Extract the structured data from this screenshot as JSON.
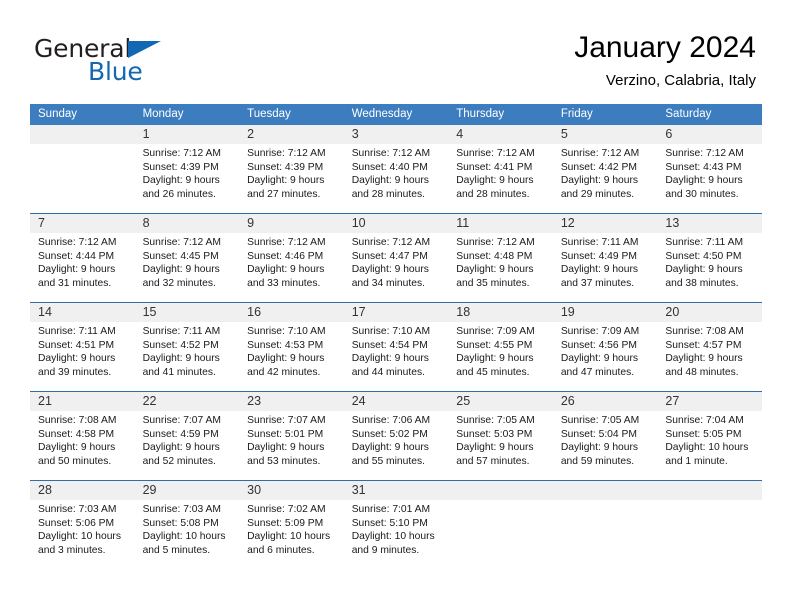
{
  "brand": {
    "name_part1": "General",
    "name_part2": "Blue",
    "accent_color": "#1268b3"
  },
  "header": {
    "month_title": "January 2024",
    "location": "Verzino, Calabria, Italy"
  },
  "calendar": {
    "header_color": "#3c7dc0",
    "weekday_headers": [
      "Sunday",
      "Monday",
      "Tuesday",
      "Wednesday",
      "Thursday",
      "Friday",
      "Saturday"
    ],
    "weeks": [
      [
        {
          "day": "",
          "lines": []
        },
        {
          "day": "1",
          "lines": [
            "Sunrise: 7:12 AM",
            "Sunset: 4:39 PM",
            "Daylight: 9 hours",
            "and 26 minutes."
          ]
        },
        {
          "day": "2",
          "lines": [
            "Sunrise: 7:12 AM",
            "Sunset: 4:39 PM",
            "Daylight: 9 hours",
            "and 27 minutes."
          ]
        },
        {
          "day": "3",
          "lines": [
            "Sunrise: 7:12 AM",
            "Sunset: 4:40 PM",
            "Daylight: 9 hours",
            "and 28 minutes."
          ]
        },
        {
          "day": "4",
          "lines": [
            "Sunrise: 7:12 AM",
            "Sunset: 4:41 PM",
            "Daylight: 9 hours",
            "and 28 minutes."
          ]
        },
        {
          "day": "5",
          "lines": [
            "Sunrise: 7:12 AM",
            "Sunset: 4:42 PM",
            "Daylight: 9 hours",
            "and 29 minutes."
          ]
        },
        {
          "day": "6",
          "lines": [
            "Sunrise: 7:12 AM",
            "Sunset: 4:43 PM",
            "Daylight: 9 hours",
            "and 30 minutes."
          ]
        }
      ],
      [
        {
          "day": "7",
          "lines": [
            "Sunrise: 7:12 AM",
            "Sunset: 4:44 PM",
            "Daylight: 9 hours",
            "and 31 minutes."
          ]
        },
        {
          "day": "8",
          "lines": [
            "Sunrise: 7:12 AM",
            "Sunset: 4:45 PM",
            "Daylight: 9 hours",
            "and 32 minutes."
          ]
        },
        {
          "day": "9",
          "lines": [
            "Sunrise: 7:12 AM",
            "Sunset: 4:46 PM",
            "Daylight: 9 hours",
            "and 33 minutes."
          ]
        },
        {
          "day": "10",
          "lines": [
            "Sunrise: 7:12 AM",
            "Sunset: 4:47 PM",
            "Daylight: 9 hours",
            "and 34 minutes."
          ]
        },
        {
          "day": "11",
          "lines": [
            "Sunrise: 7:12 AM",
            "Sunset: 4:48 PM",
            "Daylight: 9 hours",
            "and 35 minutes."
          ]
        },
        {
          "day": "12",
          "lines": [
            "Sunrise: 7:11 AM",
            "Sunset: 4:49 PM",
            "Daylight: 9 hours",
            "and 37 minutes."
          ]
        },
        {
          "day": "13",
          "lines": [
            "Sunrise: 7:11 AM",
            "Sunset: 4:50 PM",
            "Daylight: 9 hours",
            "and 38 minutes."
          ]
        }
      ],
      [
        {
          "day": "14",
          "lines": [
            "Sunrise: 7:11 AM",
            "Sunset: 4:51 PM",
            "Daylight: 9 hours",
            "and 39 minutes."
          ]
        },
        {
          "day": "15",
          "lines": [
            "Sunrise: 7:11 AM",
            "Sunset: 4:52 PM",
            "Daylight: 9 hours",
            "and 41 minutes."
          ]
        },
        {
          "day": "16",
          "lines": [
            "Sunrise: 7:10 AM",
            "Sunset: 4:53 PM",
            "Daylight: 9 hours",
            "and 42 minutes."
          ]
        },
        {
          "day": "17",
          "lines": [
            "Sunrise: 7:10 AM",
            "Sunset: 4:54 PM",
            "Daylight: 9 hours",
            "and 44 minutes."
          ]
        },
        {
          "day": "18",
          "lines": [
            "Sunrise: 7:09 AM",
            "Sunset: 4:55 PM",
            "Daylight: 9 hours",
            "and 45 minutes."
          ]
        },
        {
          "day": "19",
          "lines": [
            "Sunrise: 7:09 AM",
            "Sunset: 4:56 PM",
            "Daylight: 9 hours",
            "and 47 minutes."
          ]
        },
        {
          "day": "20",
          "lines": [
            "Sunrise: 7:08 AM",
            "Sunset: 4:57 PM",
            "Daylight: 9 hours",
            "and 48 minutes."
          ]
        }
      ],
      [
        {
          "day": "21",
          "lines": [
            "Sunrise: 7:08 AM",
            "Sunset: 4:58 PM",
            "Daylight: 9 hours",
            "and 50 minutes."
          ]
        },
        {
          "day": "22",
          "lines": [
            "Sunrise: 7:07 AM",
            "Sunset: 4:59 PM",
            "Daylight: 9 hours",
            "and 52 minutes."
          ]
        },
        {
          "day": "23",
          "lines": [
            "Sunrise: 7:07 AM",
            "Sunset: 5:01 PM",
            "Daylight: 9 hours",
            "and 53 minutes."
          ]
        },
        {
          "day": "24",
          "lines": [
            "Sunrise: 7:06 AM",
            "Sunset: 5:02 PM",
            "Daylight: 9 hours",
            "and 55 minutes."
          ]
        },
        {
          "day": "25",
          "lines": [
            "Sunrise: 7:05 AM",
            "Sunset: 5:03 PM",
            "Daylight: 9 hours",
            "and 57 minutes."
          ]
        },
        {
          "day": "26",
          "lines": [
            "Sunrise: 7:05 AM",
            "Sunset: 5:04 PM",
            "Daylight: 9 hours",
            "and 59 minutes."
          ]
        },
        {
          "day": "27",
          "lines": [
            "Sunrise: 7:04 AM",
            "Sunset: 5:05 PM",
            "Daylight: 10 hours",
            "and 1 minute."
          ]
        }
      ],
      [
        {
          "day": "28",
          "lines": [
            "Sunrise: 7:03 AM",
            "Sunset: 5:06 PM",
            "Daylight: 10 hours",
            "and 3 minutes."
          ]
        },
        {
          "day": "29",
          "lines": [
            "Sunrise: 7:03 AM",
            "Sunset: 5:08 PM",
            "Daylight: 10 hours",
            "and 5 minutes."
          ]
        },
        {
          "day": "30",
          "lines": [
            "Sunrise: 7:02 AM",
            "Sunset: 5:09 PM",
            "Daylight: 10 hours",
            "and 6 minutes."
          ]
        },
        {
          "day": "31",
          "lines": [
            "Sunrise: 7:01 AM",
            "Sunset: 5:10 PM",
            "Daylight: 10 hours",
            "and 9 minutes."
          ]
        },
        {
          "day": "",
          "lines": []
        },
        {
          "day": "",
          "lines": []
        },
        {
          "day": "",
          "lines": []
        }
      ]
    ]
  }
}
